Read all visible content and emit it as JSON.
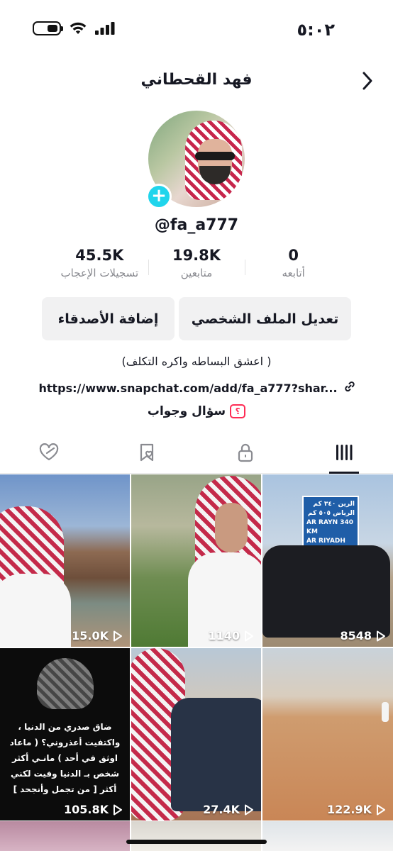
{
  "status_bar": {
    "time": "٥:٠٢",
    "battery_level": 0.45
  },
  "header": {
    "title": "فهد القحطاني"
  },
  "profile": {
    "username": "@fa_a777",
    "stats": [
      {
        "value": "0",
        "label": "أتابعه"
      },
      {
        "value": "19.8K",
        "label": "متابعين"
      },
      {
        "value": "45.5K",
        "label": "تسجيلات الإعجاب"
      }
    ],
    "edit_button": "تعديل الملف الشخصي",
    "add_friends_button": "إضافة الأصدقاء",
    "bio": "(اعشق البساطه واكره التكلف )",
    "link": "https://www.snapchat.com/add/fa_a777?shar...",
    "qa_label": "سؤال وجواب",
    "qa_icon_glyph": "؟"
  },
  "tabs": [
    {
      "icon": "grid-icon",
      "active": true
    },
    {
      "icon": "lock-icon",
      "active": false
    },
    {
      "icon": "bookmark-heart-icon",
      "active": false
    },
    {
      "icon": "liked-heart-icon",
      "active": false
    }
  ],
  "videos": [
    {
      "views": "8548"
    },
    {
      "views": "1140"
    },
    {
      "views": "15.0K"
    },
    {
      "views": "122.9K"
    },
    {
      "views": "27.4K"
    },
    {
      "views": "105.8K"
    }
  ],
  "thumb_text": {
    "sign_line1": "الرين ٣٤٠ كم",
    "sign_line2": "الرياض ٥٠٥ كم",
    "sign_line3": "AR RAYN 340 KM",
    "sign_line4": "AR RIYADH 505 KM",
    "quote": "ضاق صدري من الدنيا ، واكتفيت أعذروني؟ ( ماعاد اوثق في أحد ) مانـي أكثر شخص بـ الدنيا وفيت لكني أكثر [ من تجمل وأنجحد ]"
  }
}
